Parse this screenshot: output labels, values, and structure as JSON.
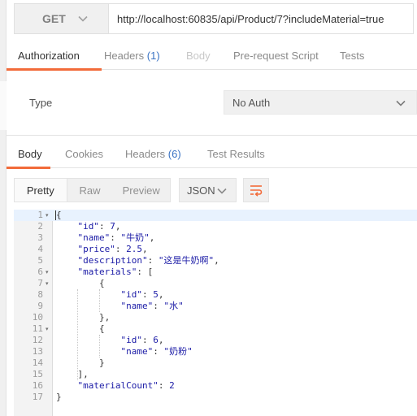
{
  "request": {
    "method": "GET",
    "url": "http://localhost:60835/api/Product/7?includeMaterial=true"
  },
  "request_tabs": [
    {
      "label": "Authorization",
      "count": null,
      "state": "active"
    },
    {
      "label": "Headers",
      "count": "(1)",
      "state": "normal"
    },
    {
      "label": "Body",
      "count": null,
      "state": "disabled"
    },
    {
      "label": "Pre-request Script",
      "count": null,
      "state": "normal"
    },
    {
      "label": "Tests",
      "count": null,
      "state": "normal"
    }
  ],
  "auth": {
    "type_label": "Type",
    "selected": "No Auth"
  },
  "response_tabs": [
    {
      "label": "Body",
      "count": null,
      "state": "active"
    },
    {
      "label": "Cookies",
      "count": null,
      "state": "normal"
    },
    {
      "label": "Headers",
      "count": "(6)",
      "state": "normal"
    },
    {
      "label": "Test Results",
      "count": null,
      "state": "normal"
    }
  ],
  "view_modes": [
    "Pretty",
    "Raw",
    "Preview"
  ],
  "active_view": "Pretty",
  "format": "JSON",
  "icons": {
    "method_dropdown": "chevron-down-icon",
    "auth_dropdown": "chevron-down-icon",
    "format_dropdown": "chevron-down-icon",
    "wrap": "wrap-lines-icon",
    "fold": "fold-arrow-icon"
  },
  "colors": {
    "accent": "#f26b3a",
    "count": "#3a73c4",
    "json_value": "#1a1aa6"
  },
  "code_lines": [
    {
      "n": "1",
      "fold": true,
      "tokens": [
        {
          "t": "{",
          "c": "p"
        }
      ]
    },
    {
      "n": "2",
      "fold": false,
      "tokens": [
        {
          "t": "    ",
          "c": "p"
        },
        {
          "t": "\"id\"",
          "c": "k"
        },
        {
          "t": ": ",
          "c": "p"
        },
        {
          "t": "7",
          "c": "n"
        },
        {
          "t": ",",
          "c": "p"
        }
      ]
    },
    {
      "n": "3",
      "fold": false,
      "tokens": [
        {
          "t": "    ",
          "c": "p"
        },
        {
          "t": "\"name\"",
          "c": "k"
        },
        {
          "t": ": ",
          "c": "p"
        },
        {
          "t": "\"牛奶\"",
          "c": "s"
        },
        {
          "t": ",",
          "c": "p"
        }
      ]
    },
    {
      "n": "4",
      "fold": false,
      "tokens": [
        {
          "t": "    ",
          "c": "p"
        },
        {
          "t": "\"price\"",
          "c": "k"
        },
        {
          "t": ": ",
          "c": "p"
        },
        {
          "t": "2.5",
          "c": "n"
        },
        {
          "t": ",",
          "c": "p"
        }
      ]
    },
    {
      "n": "5",
      "fold": false,
      "tokens": [
        {
          "t": "    ",
          "c": "p"
        },
        {
          "t": "\"description\"",
          "c": "k"
        },
        {
          "t": ": ",
          "c": "p"
        },
        {
          "t": "\"这是牛奶啊\"",
          "c": "s"
        },
        {
          "t": ",",
          "c": "p"
        }
      ]
    },
    {
      "n": "6",
      "fold": true,
      "tokens": [
        {
          "t": "    ",
          "c": "p"
        },
        {
          "t": "\"materials\"",
          "c": "k"
        },
        {
          "t": ": [",
          "c": "p"
        }
      ]
    },
    {
      "n": "7",
      "fold": true,
      "tokens": [
        {
          "t": "        {",
          "c": "p"
        }
      ]
    },
    {
      "n": "8",
      "fold": false,
      "tokens": [
        {
          "t": "            ",
          "c": "p"
        },
        {
          "t": "\"id\"",
          "c": "k"
        },
        {
          "t": ": ",
          "c": "p"
        },
        {
          "t": "5",
          "c": "n"
        },
        {
          "t": ",",
          "c": "p"
        }
      ]
    },
    {
      "n": "9",
      "fold": false,
      "tokens": [
        {
          "t": "            ",
          "c": "p"
        },
        {
          "t": "\"name\"",
          "c": "k"
        },
        {
          "t": ": ",
          "c": "p"
        },
        {
          "t": "\"水\"",
          "c": "s"
        }
      ]
    },
    {
      "n": "10",
      "fold": false,
      "tokens": [
        {
          "t": "        },",
          "c": "p"
        }
      ]
    },
    {
      "n": "11",
      "fold": true,
      "tokens": [
        {
          "t": "        {",
          "c": "p"
        }
      ]
    },
    {
      "n": "12",
      "fold": false,
      "tokens": [
        {
          "t": "            ",
          "c": "p"
        },
        {
          "t": "\"id\"",
          "c": "k"
        },
        {
          "t": ": ",
          "c": "p"
        },
        {
          "t": "6",
          "c": "n"
        },
        {
          "t": ",",
          "c": "p"
        }
      ]
    },
    {
      "n": "13",
      "fold": false,
      "tokens": [
        {
          "t": "            ",
          "c": "p"
        },
        {
          "t": "\"name\"",
          "c": "k"
        },
        {
          "t": ": ",
          "c": "p"
        },
        {
          "t": "\"奶粉\"",
          "c": "s"
        }
      ]
    },
    {
      "n": "14",
      "fold": false,
      "tokens": [
        {
          "t": "        }",
          "c": "p"
        }
      ]
    },
    {
      "n": "15",
      "fold": false,
      "tokens": [
        {
          "t": "    ],",
          "c": "p"
        }
      ]
    },
    {
      "n": "16",
      "fold": false,
      "tokens": [
        {
          "t": "    ",
          "c": "p"
        },
        {
          "t": "\"materialCount\"",
          "c": "k"
        },
        {
          "t": ": ",
          "c": "p"
        },
        {
          "t": "2",
          "c": "n"
        }
      ]
    },
    {
      "n": "17",
      "fold": false,
      "tokens": [
        {
          "t": "}",
          "c": "p"
        }
      ]
    }
  ]
}
